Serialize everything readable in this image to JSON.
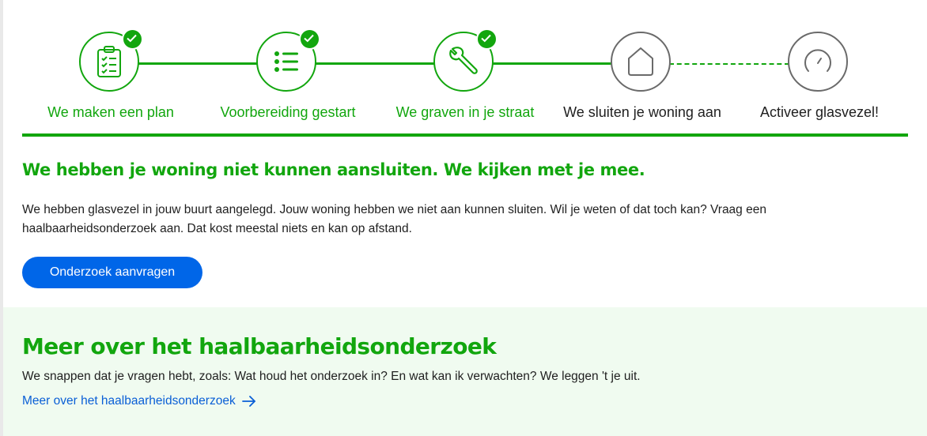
{
  "progress": {
    "steps": [
      {
        "label": "We maken een plan",
        "status": "done",
        "icon": "checklist-icon"
      },
      {
        "label": "Voorbereiding gestart",
        "status": "done",
        "icon": "list-icon"
      },
      {
        "label": "We graven in je straat",
        "status": "done",
        "icon": "wrench-icon"
      },
      {
        "label": "We sluiten je woning aan",
        "status": "todo",
        "icon": "house-icon"
      },
      {
        "label": "Activeer glasvezel!",
        "status": "todo",
        "icon": "speedometer-icon"
      }
    ]
  },
  "status": {
    "headline": "We hebben je woning niet kunnen aansluiten. We kijken met je mee.",
    "body": "We hebben glasvezel in jouw buurt aangelegd. Jouw woning hebben we niet aan kunnen sluiten. Wil je weten of dat toch kan? Vraag een haalbaarheidsonderzoek aan. Dat kost meestal niets en kan op afstand.",
    "button_label": "Onderzoek aanvragen"
  },
  "info": {
    "title": "Meer over het haalbaarheidsonderzoek",
    "text": "We snappen dat je vragen hebt, zoals: Wat houd het onderzoek in? En wat kan ik verwachten? We leggen 't je uit.",
    "link_label": "Meer over het haalbaarheidsonderzoek"
  },
  "colors": {
    "accent_green": "#12a60e",
    "button_blue": "#0066e8",
    "link_blue": "#0a5fd6",
    "panel_background": "#f0fbf0",
    "inactive_gray": "#6a6a6a"
  }
}
